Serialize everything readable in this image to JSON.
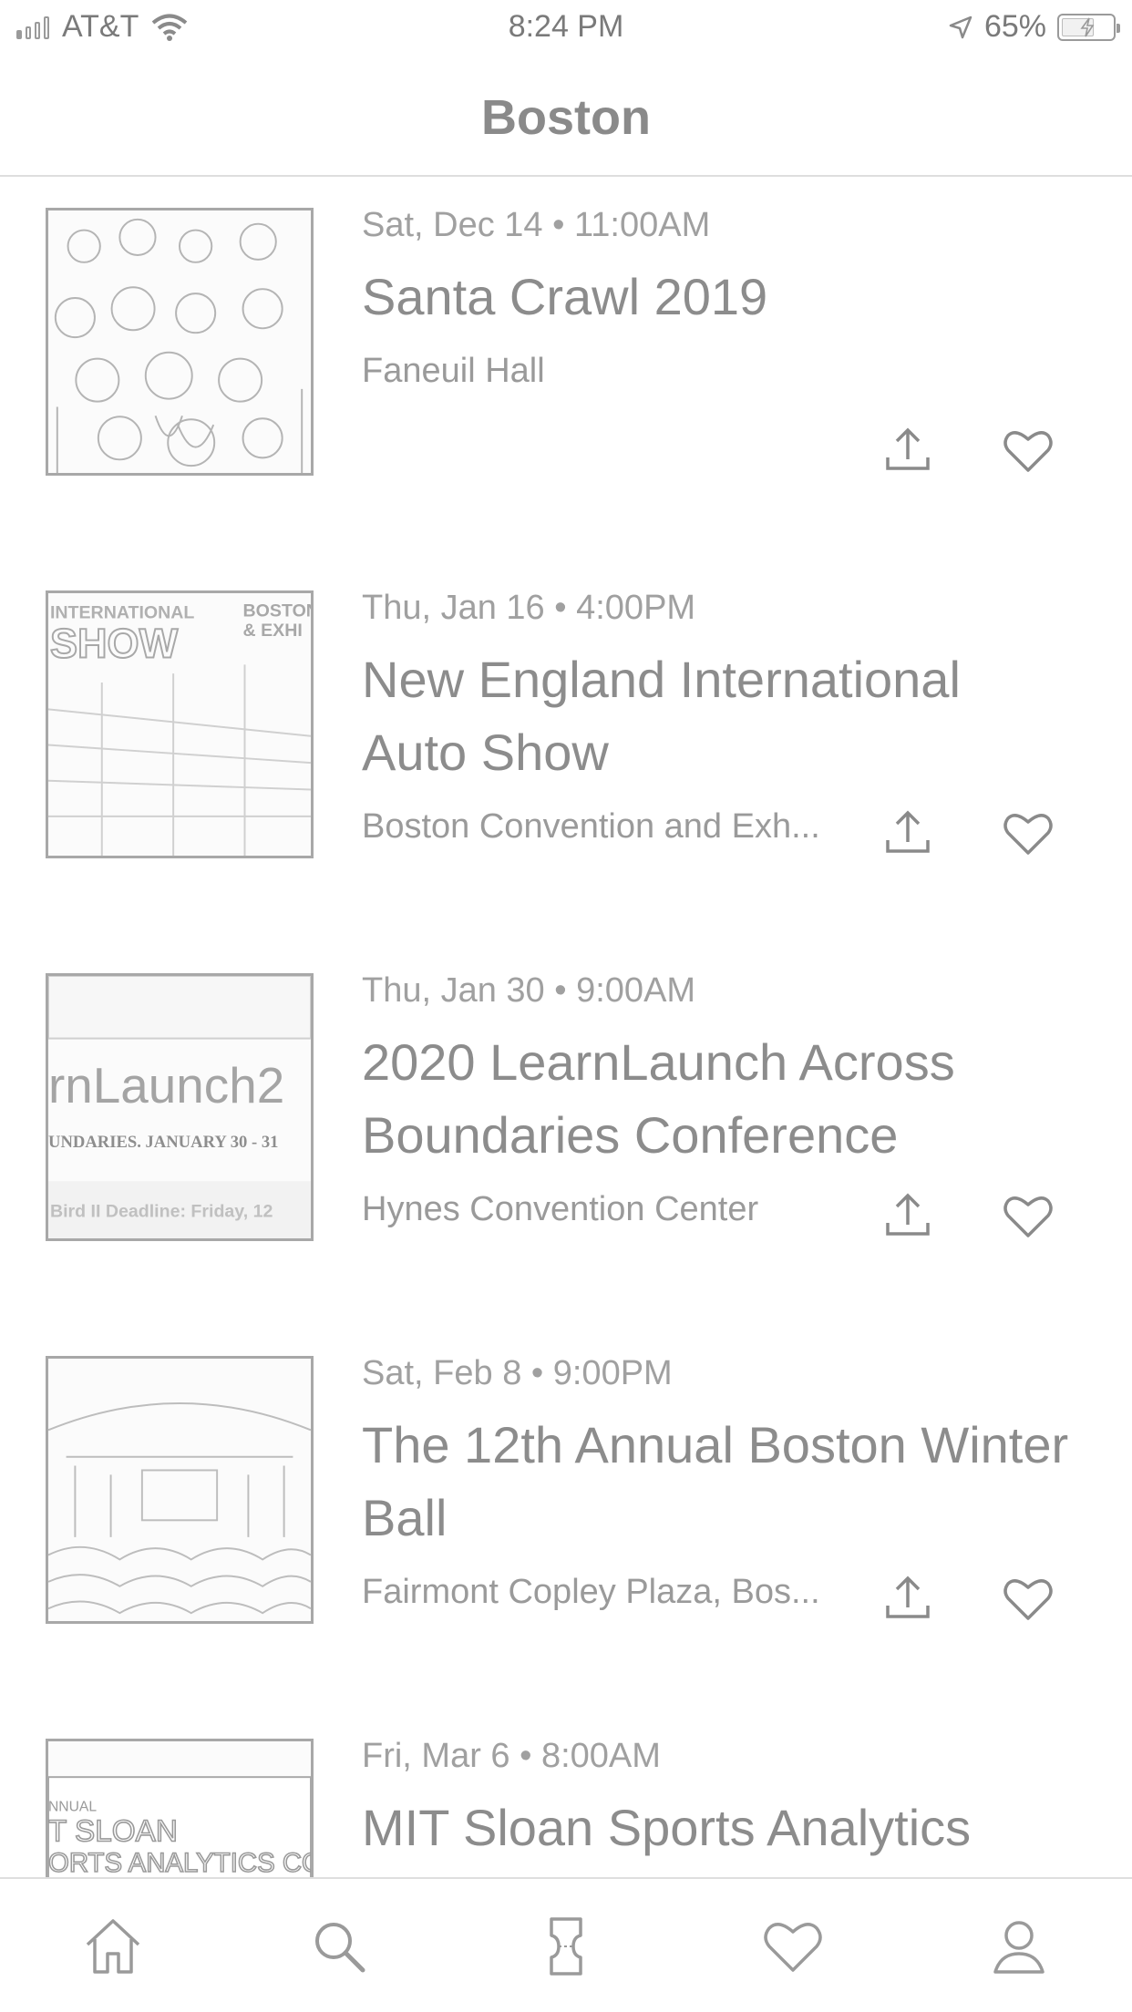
{
  "status_bar": {
    "carrier": "AT&T",
    "time": "8:24 PM",
    "battery": "65%",
    "battery_level": 0.65,
    "signal_bars": 1
  },
  "header": {
    "title": "Boston"
  },
  "events": [
    {
      "date": "Sat, Dec 14 • 11:00AM",
      "title": "Santa Crawl 2019",
      "venue": "Faneuil Hall",
      "thumbnail": "santa-crowd-photo"
    },
    {
      "date": "Thu, Jan 16 • 4:00PM",
      "title": "New England International Auto Show",
      "venue": "Boston Convention and Exh...",
      "thumbnail": "auto-show-poster",
      "thumb_text": [
        "INTERNATIONAL",
        "SHOW",
        "BOSTON",
        "& EXHI"
      ]
    },
    {
      "date": "Thu, Jan 30 • 9:00AM",
      "title": "2020 LearnLaunch Across Boundaries Conference",
      "venue": "Hynes Convention Center",
      "thumbnail": "learnlaunch-poster",
      "thumb_text": [
        "rnLaunch2",
        "UNDARIES. JANUARY 30 - 31",
        "Bird II Deadline: Friday, 12"
      ]
    },
    {
      "date": "Sat, Feb 8 • 9:00PM",
      "title": "The 12th Annual Boston Winter Ball",
      "venue": "Fairmont Copley Plaza, Bos...",
      "thumbnail": "winter-ball-photo"
    },
    {
      "date": "Fri, Mar 6 • 8:00AM",
      "title": "MIT Sloan Sports Analytics",
      "venue": "",
      "thumbnail": "sloan-poster",
      "thumb_text": [
        "NNUAL",
        "T SLOAN",
        "ORTS ANALYTICS CON"
      ]
    }
  ],
  "actions": {
    "share_icon": "share-icon",
    "like_icon": "heart-icon"
  },
  "tab_bar": {
    "tabs": [
      {
        "icon": "home-icon"
      },
      {
        "icon": "search-icon"
      },
      {
        "icon": "ticket-icon"
      },
      {
        "icon": "heart-icon"
      },
      {
        "icon": "profile-icon"
      }
    ]
  },
  "colors": {
    "text_primary": "#8c8c8c",
    "text_secondary": "#a0a0a0",
    "divider": "#dedede",
    "background": "#ffffff"
  }
}
